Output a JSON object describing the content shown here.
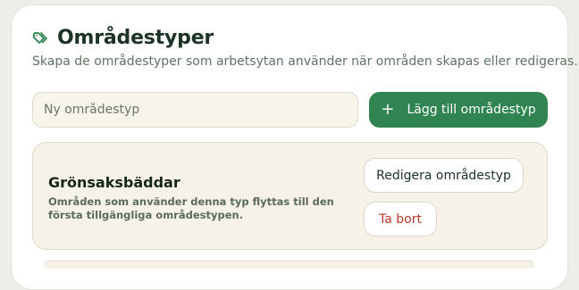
{
  "header": {
    "icon": "tags-icon",
    "title": "Områdestyper",
    "subtitle": "Skapa de områdestyper som arbetsytan använder när områden skapas eller redigeras."
  },
  "new_type": {
    "placeholder": "Ny områdestyp",
    "value": "",
    "add_icon": "plus-icon",
    "add_label": "Lägg till områdestyp"
  },
  "types": [
    {
      "name": "Grönsaksbäddar",
      "description": "Områden som använder denna typ flyttas till den första tillgängliga områdestypen.",
      "edit_label": "Redigera områdestyp",
      "delete_label": "Ta bort"
    }
  ],
  "colors": {
    "accent": "#2f8451",
    "danger": "#c0392b",
    "title": "#1d3325",
    "card_bg": "#f6f2e8"
  }
}
